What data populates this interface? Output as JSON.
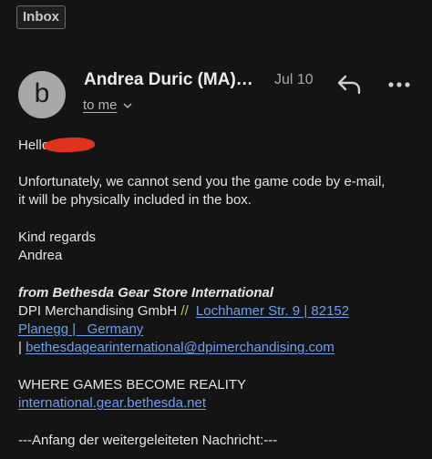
{
  "label": "Inbox",
  "header": {
    "avatar_letter": "b",
    "sender": "Andrea Duric (MA)…",
    "date": "Jul 10",
    "recipient": "to me"
  },
  "icons": {
    "reply": "reply-arrow-icon",
    "more": "more-horizontal-icon",
    "chevron": "chevron-down-icon",
    "redaction": "red-redaction-scribble"
  },
  "colors": {
    "background": "#141414",
    "link": "#6d9ff0",
    "redaction": "#e0331f",
    "separator": "#b9c94a",
    "avatar": "#a8a8a8"
  },
  "message": {
    "greeting": "Hello",
    "line1": "Unfortunately, we cannot send you the game code by e-mail,",
    "line2": "it will be physically included in the box.",
    "regards": "Kind regards",
    "name": "Andrea",
    "sig_company": "from Bethesda Gear Store International",
    "sig_legal": "DPI Merchandising GmbH",
    "sig_sep": "//",
    "sig_address1": "Lochhamer Str. 9 | 82152",
    "sig_address2": "Planegg |   Germany",
    "sig_pipe": "|",
    "sig_email": "bethesdagearinternational@dpimerchandising.com",
    "slogan": "WHERE GAMES BECOME REALITY",
    "website": "international.gear.bethesda.net",
    "forwarded": "---Anfang der weitergeleiteten Nachricht:---"
  }
}
